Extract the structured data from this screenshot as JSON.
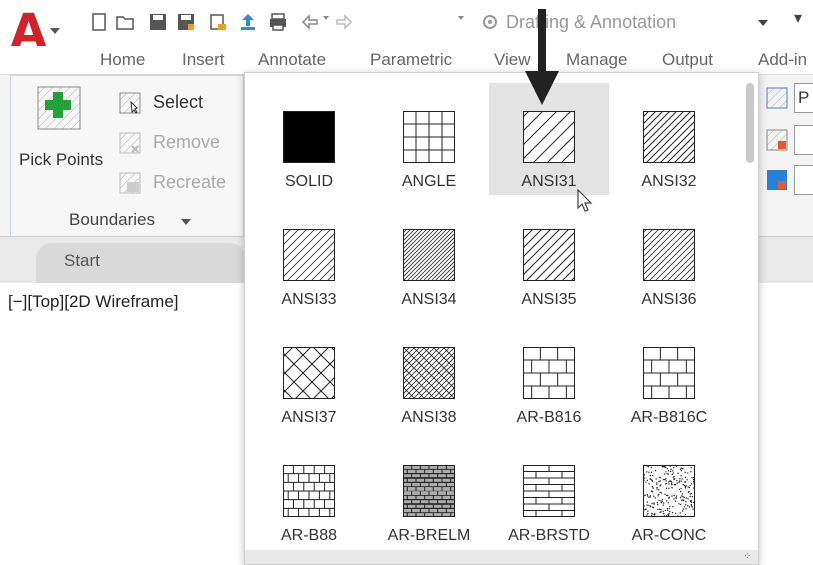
{
  "app": {
    "letter": "A",
    "workspace": "Drafting & Annotation",
    "qat_icons": [
      "new-icon",
      "open-icon",
      "save-icon",
      "save-as-icon",
      "cloud-icon",
      "share-icon",
      "plot-icon",
      "undo-icon",
      "redo-icon"
    ]
  },
  "tabs": [
    {
      "label": "Home"
    },
    {
      "label": "Insert"
    },
    {
      "label": "Annotate"
    },
    {
      "label": "Parametric"
    },
    {
      "label": "View"
    },
    {
      "label": "Manage"
    },
    {
      "label": "Output"
    },
    {
      "label": "Add-in"
    }
  ],
  "ribbon": {
    "pick_points": "Pick Points",
    "select": "Select",
    "remove": "Remove",
    "recreate": "Recreate",
    "boundaries": "Boundaries",
    "right_field_letter": "P"
  },
  "doc": {
    "start_tab": "Start",
    "viewport_label": "[−][Top][2D Wireframe]"
  },
  "patterns": [
    {
      "label": "SOLID",
      "selected": false
    },
    {
      "label": "ANGLE",
      "selected": false
    },
    {
      "label": "ANSI31",
      "selected": true
    },
    {
      "label": "ANSI32",
      "selected": false
    },
    {
      "label": "ANSI33",
      "selected": false
    },
    {
      "label": "ANSI34",
      "selected": false
    },
    {
      "label": "ANSI35",
      "selected": false
    },
    {
      "label": "ANSI36",
      "selected": false
    },
    {
      "label": "ANSI37",
      "selected": false
    },
    {
      "label": "ANSI38",
      "selected": false
    },
    {
      "label": "AR-B816",
      "selected": false
    },
    {
      "label": "AR-B816C",
      "selected": false
    },
    {
      "label": "AR-B88",
      "selected": false
    },
    {
      "label": "AR-BRELM",
      "selected": false
    },
    {
      "label": "AR-BRSTD",
      "selected": false
    },
    {
      "label": "AR-CONC",
      "selected": false
    }
  ],
  "colors": {
    "accent": "#d1232a",
    "selection": "#e3e3e3",
    "panel_border": "#c8d7e8"
  }
}
